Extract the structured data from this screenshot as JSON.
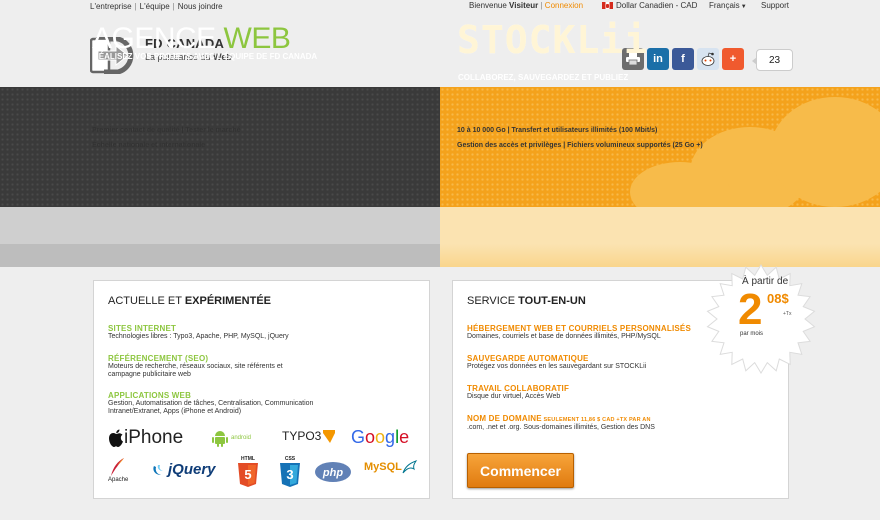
{
  "topbar": {
    "left_links": [
      "L'entreprise",
      "L'équipe",
      "Nous joindre"
    ],
    "welcome": "Bienvenue",
    "visitor": "Visiteur",
    "login": "Connexion",
    "currency": "Dollar Canadien - CAD",
    "language": "Français",
    "support": "Support"
  },
  "brand": {
    "name": "FD CANADA",
    "tagline_pre": "La puissance du ",
    "tagline_bold": "Web"
  },
  "share": {
    "count": "23",
    "icons": [
      "print-icon",
      "linkedin-icon",
      "facebook-icon",
      "reddit-icon",
      "plus-icon"
    ]
  },
  "banner": {
    "left": {
      "title_a": "AGENCE ",
      "title_b": "WEB",
      "subtitle": "RÉALISEZ VOS PROJETS AVEC L'ÉQUIPE DE FD CANADA",
      "line1": "Premier contact de qualité | Tester le marché",
      "line2": "Échelle nationale et internationale"
    },
    "right": {
      "title": "STOCKLii",
      "subtitle": "COLLABOREZ, SAUVEGARDEZ ET PUBLIEZ",
      "line1": "10 à 10 000 Go | Transfert et utilisateurs illimités (100 Mbit/s)",
      "line2": "Gestion des accès et privilèges | Fichiers volumineux supportés (25 Go +)"
    }
  },
  "left_panel": {
    "title_a": "ACTUELLE ET ",
    "title_b": "EXPÉRIMENTÉE",
    "sections": [
      {
        "heading": "SITES INTERNET",
        "text": "Technologies libres : Typo3, Apache, PHP, MySQL, jQuery"
      },
      {
        "heading": "RÉFÉRENCEMENT (SEO)",
        "text": "Moteurs de recherche, réseaux sociaux, site référents et campagne publicitaire web"
      },
      {
        "heading": "APPLICATIONS WEB",
        "text": "Gestion, Automatisation de tâches, Centralisation, Communication Intranet/Extranet, Apps (iPhone et Android)"
      }
    ],
    "logos": {
      "iphone": "iPhone",
      "android": "android",
      "typo3": "TYPO3",
      "google": [
        "G",
        "o",
        "o",
        "g",
        "l",
        "e"
      ],
      "apache": "Apache",
      "jquery": "jQuery",
      "html": "HTML",
      "css": "CSS",
      "php": "php",
      "mysql": "MySQL"
    }
  },
  "right_panel": {
    "title_a": "SERVICE ",
    "title_b": "TOUT-EN-UN",
    "sections": [
      {
        "heading": "HÉBERGEMENT WEB ET COURRIELS PERSONNALISÉS",
        "text": "Domaines, courriels et base de données illimités, PHP/MySQL"
      },
      {
        "heading": "SAUVEGARDE AUTOMATIQUE",
        "text": "Protégez vos données en les sauvegardant sur STOCKLii"
      },
      {
        "heading": "TRAVAIL COLLABORATIF",
        "text": "Disque dur virtuel, Accès Web"
      },
      {
        "heading": "NOM DE DOMAINE",
        "heading_small": " SEULEMENT 11,86 $ CAD +TX PAR AN",
        "text": ".com, .net et .org. Sous-domaines illimités, Gestion des DNS"
      }
    ],
    "button": "Commencer"
  },
  "price": {
    "prefix": "À partir de",
    "amount": "2",
    "cents": "08$",
    "tax": "+Tx",
    "period": "par mois"
  },
  "colors": {
    "green": "#8dc63f",
    "orange": "#f08a00",
    "dark_banner": "#3a3a3a",
    "orange_banner": "#f4a21c"
  }
}
